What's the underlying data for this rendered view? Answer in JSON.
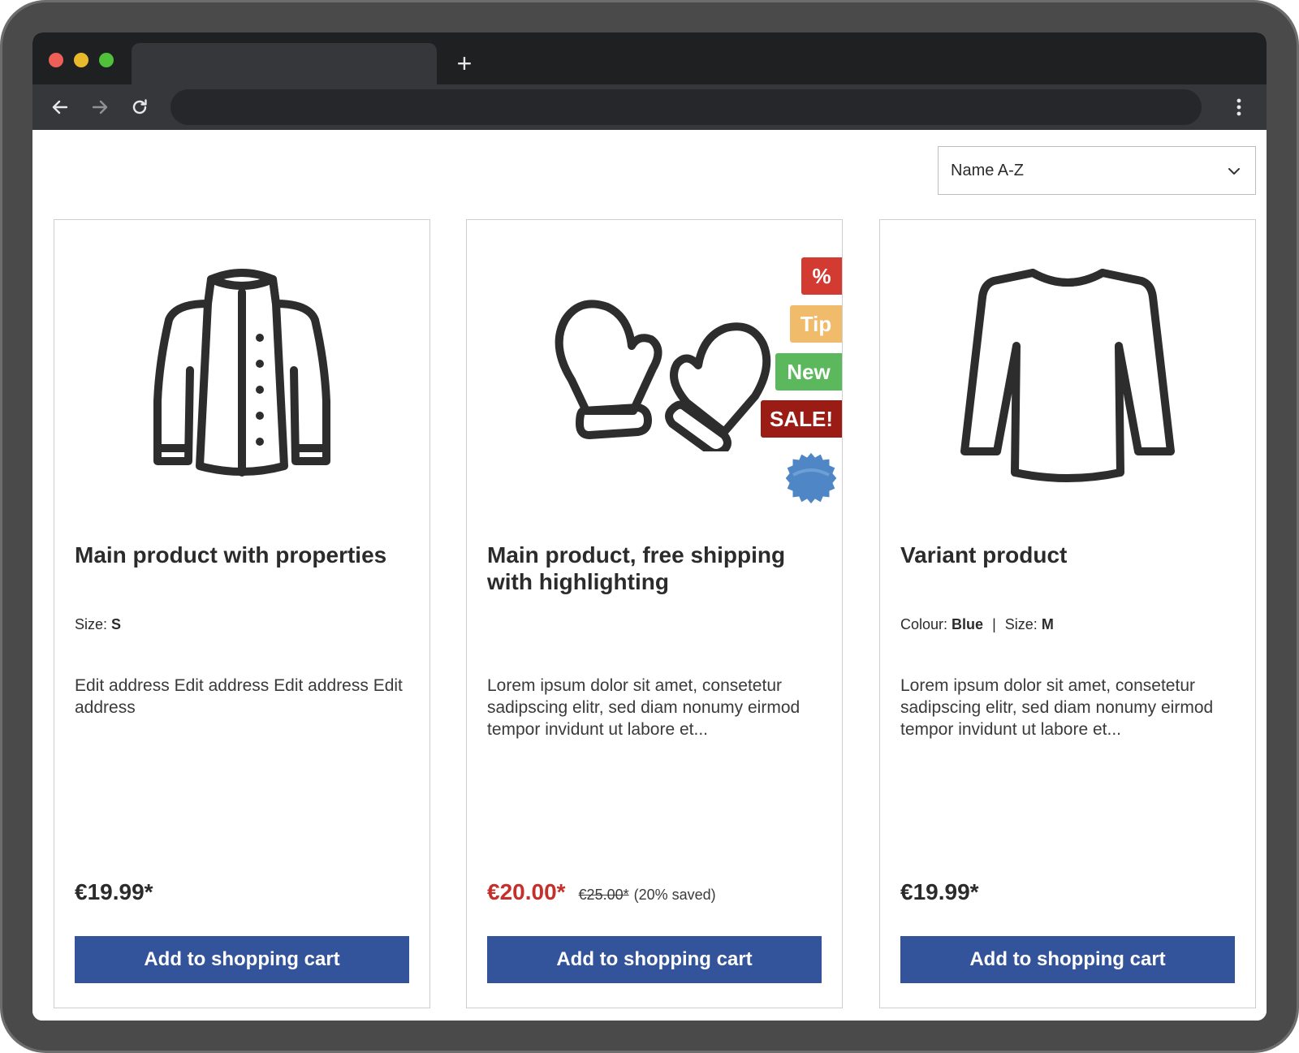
{
  "browser": {
    "new_tab_label": "+"
  },
  "sorting": {
    "selected": "Name A-Z"
  },
  "products": [
    {
      "name": "Main product with properties",
      "properties": [
        {
          "label": "Size:",
          "value": "S"
        }
      ],
      "description": "Edit address Edit address Edit address Edit address",
      "price": "€19.99*",
      "button_label": "Add to shopping cart",
      "icon": "jacket-icon"
    },
    {
      "name": "Main product, free shipping with highlighting",
      "description": "Lorem ipsum dolor sit amet, consetetur sadipscing elitr, sed diam nonumy eirmod tempor invidunt ut labore et...",
      "price": "€20.00*",
      "list_price": "€25.00*",
      "saved": "(20% saved)",
      "button_label": "Add to shopping cart",
      "icon": "mittens-icon",
      "badges": {
        "discount": "%",
        "tip": "Tip",
        "new": "New",
        "sale": "SALE!"
      }
    },
    {
      "name": "Variant product",
      "properties": [
        {
          "label": "Colour:",
          "value": "Blue"
        },
        {
          "label": "Size:",
          "value": "M"
        }
      ],
      "description": "Lorem ipsum dolor sit amet, consetetur sadipscing elitr, sed diam nonumy eirmod tempor invidunt ut labore et...",
      "price": "€19.99*",
      "button_label": "Add to shopping cart",
      "icon": "longsleeve-icon"
    }
  ],
  "colors": {
    "button": "#33549b",
    "sale_price": "#c4302b",
    "badge_discount": "#d23a32",
    "badge_tip": "#f0bb6b",
    "badge_new": "#5cb85c",
    "badge_sale": "#9b1b15",
    "seal": "#4f86c6"
  }
}
